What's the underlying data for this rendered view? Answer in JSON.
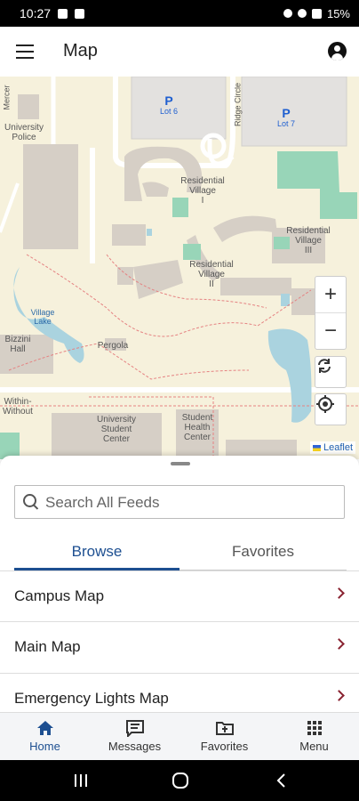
{
  "status": {
    "time": "10:27",
    "battery": "15%"
  },
  "app_bar": {
    "title": "Map"
  },
  "map": {
    "labels": {
      "university_police": "University\nPolice",
      "residential_village_i": "Residential\nVillage\nI",
      "residential_village_ii": "Residential\nVillage\nII",
      "residential_village_iii": "Residential\nVillage\nIII",
      "pergola": "Pergola",
      "bizzini_hall": "Bizzini\nHall",
      "university_student_center": "University\nStudent\nCenter",
      "student_health_center": "Student\nHealth\nCenter",
      "within_without": "Within-\nWithout",
      "village_lake": "Village\nLake",
      "ridge_circle": "Ridge Circle",
      "mercer": "Mercer",
      "lot6": "Lot 6",
      "lot7": "Lot 7",
      "parking_symbol": "P"
    },
    "zoom_in": "+",
    "zoom_out": "−",
    "attribution": "Leaflet"
  },
  "sheet": {
    "search_placeholder": "Search All Feeds",
    "tabs": [
      {
        "label": "Browse"
      },
      {
        "label": "Favorites"
      }
    ],
    "items": [
      {
        "label": "Campus Map"
      },
      {
        "label": "Main Map"
      },
      {
        "label": "Emergency Lights Map"
      }
    ]
  },
  "bottom_nav": [
    {
      "label": "Home",
      "icon": "home-icon"
    },
    {
      "label": "Messages",
      "icon": "messages-icon"
    },
    {
      "label": "Favorites",
      "icon": "favorites-folder-icon"
    },
    {
      "label": "Menu",
      "icon": "grid-menu-icon"
    }
  ],
  "colors": {
    "accent": "#1d4f91",
    "chevron": "#8a2432",
    "map_bg": "#f6f1dc",
    "building": "#d6cfc6",
    "water": "#aad3df",
    "grass": "#98d5b8"
  }
}
